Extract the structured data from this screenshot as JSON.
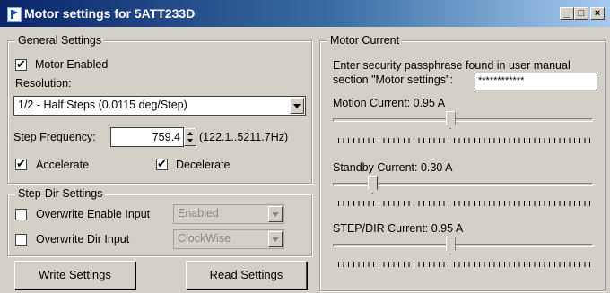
{
  "window": {
    "title": "Motor settings for 5ATT233D",
    "min_label": "_",
    "max_label": "□",
    "close_label": "×"
  },
  "general": {
    "legend": "General Settings",
    "motor_enabled_label": "Motor Enabled",
    "motor_enabled": true,
    "resolution_label": "Resolution:",
    "resolution_value": "1/2 - Half Steps (0.0115 deg/Step)",
    "step_freq_label": "Step Frequency:",
    "step_freq_value": "759.4",
    "step_freq_range": "(122.1..5211.7Hz)",
    "accelerate_label": "Accelerate",
    "accelerate": true,
    "decelerate_label": "Decelerate",
    "decelerate": true
  },
  "stepdir": {
    "legend": "Step-Dir Settings",
    "overwrite_enable_label": "Overwrite Enable Input",
    "overwrite_enable_value": "Enabled",
    "overwrite_dir_label": "Overwrite Dir Input",
    "overwrite_dir_value": "ClockWise"
  },
  "buttons": {
    "write": "Write Settings",
    "read": "Read Settings"
  },
  "current": {
    "legend": "Motor Current",
    "pass_prompt_1": "Enter security passphrase found in user manual",
    "pass_prompt_2": "section \"Motor settings\":",
    "pass_value": "************",
    "motion_label": "Motion Current: 0.95 A",
    "motion_level": 0.45,
    "standby_label": "Standby Current: 0.30 A",
    "standby_level": 0.14,
    "stepdir_label": "STEP/DIR Current: 0.95 A",
    "stepdir_level": 0.45
  }
}
